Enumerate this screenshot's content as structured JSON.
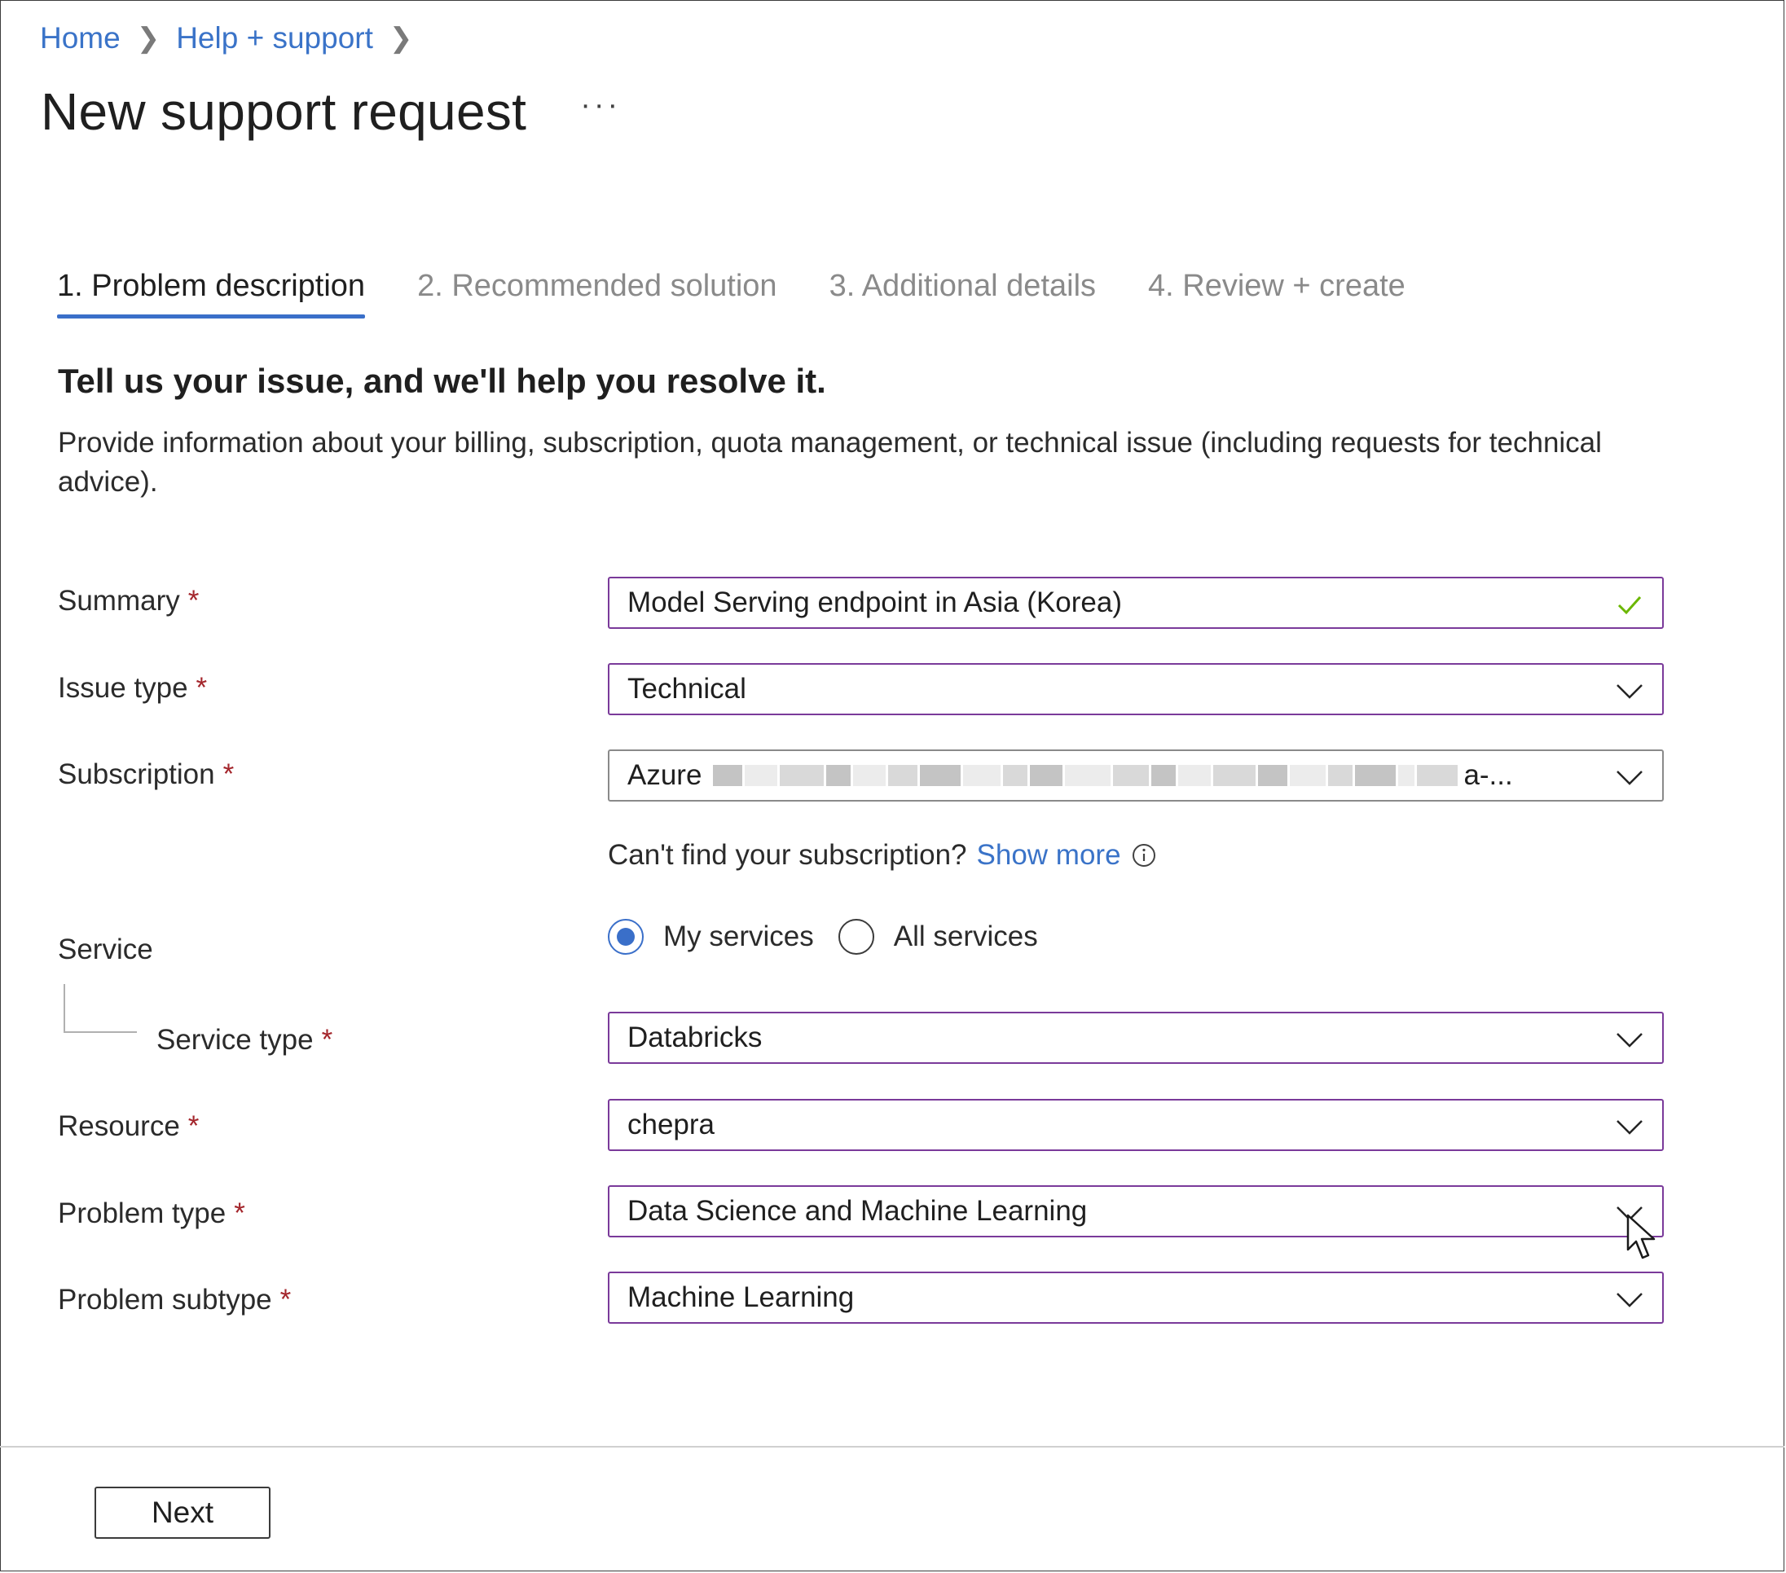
{
  "breadcrumb": {
    "home": "Home",
    "help": "Help + support"
  },
  "page": {
    "title": "New support request",
    "more": "···"
  },
  "tabs": [
    {
      "label": "1. Problem description",
      "active": true
    },
    {
      "label": "2. Recommended solution",
      "active": false
    },
    {
      "label": "3. Additional details",
      "active": false
    },
    {
      "label": "4. Review + create",
      "active": false
    }
  ],
  "intro": {
    "heading": "Tell us your issue, and we'll help you resolve it.",
    "description": "Provide information about your billing, subscription, quota management, or technical issue (including requests for technical advice)."
  },
  "form": {
    "required_mark": "*",
    "summary": {
      "label": "Summary",
      "value": "Model Serving endpoint in Asia (Korea)"
    },
    "issue_type": {
      "label": "Issue type",
      "value": "Technical"
    },
    "subscription": {
      "label": "Subscription",
      "value_prefix": "Azure",
      "value_suffix": "a-..."
    },
    "subscription_hint": {
      "text": "Can't find your subscription?",
      "link": "Show more"
    },
    "service": {
      "label": "Service",
      "options": [
        "My services",
        "All services"
      ],
      "selected": "My services"
    },
    "service_type": {
      "label": "Service type",
      "value": "Databricks"
    },
    "resource": {
      "label": "Resource",
      "value": "chepra"
    },
    "problem_type": {
      "label": "Problem type",
      "value": "Data Science and Machine Learning"
    },
    "problem_subtype": {
      "label": "Problem subtype",
      "value": "Machine Learning"
    }
  },
  "footer": {
    "next_label": "Next"
  },
  "colors": {
    "accent": "#3a6fc9",
    "link": "#3a73c8",
    "field_border": "#7a3a9a",
    "required": "#a4262c",
    "valid": "#6bb700"
  }
}
